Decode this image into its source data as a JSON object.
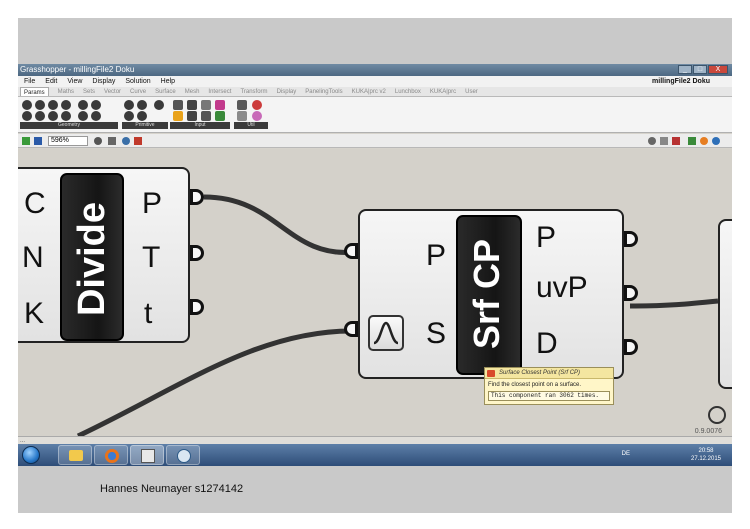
{
  "window": {
    "title": "Grasshopper - millingFile2 Doku",
    "doc_name": "millingFile2 Doku",
    "controls": [
      "_",
      "□",
      "X"
    ]
  },
  "menu": [
    "File",
    "Edit",
    "View",
    "Display",
    "Solution",
    "Help"
  ],
  "ribbon_tabs": [
    "Params",
    "Maths",
    "Sets",
    "Vector",
    "Curve",
    "Surface",
    "Mesh",
    "Intersect",
    "Transform",
    "Display",
    "PanelingTools",
    "KUKA|prc v2",
    "Lunchbox",
    "KUKA|prc",
    "User"
  ],
  "ribbon_groups": [
    "Geometry",
    "Primitive",
    "Input",
    "Util"
  ],
  "canvas_toolbar": {
    "zoom": "596%"
  },
  "components": {
    "divide": {
      "name": "Divide",
      "inputs": [
        "C",
        "N",
        "K"
      ],
      "outputs": [
        "P",
        "T",
        "t"
      ]
    },
    "srf_cp": {
      "name": "Srf CP",
      "inputs": [
        "P",
        "S"
      ],
      "outputs": [
        "P",
        "uvP",
        "D"
      ]
    }
  },
  "tooltip": {
    "title": "Surface Closest Point (Srf CP)",
    "description": "Find the closest point on a surface.",
    "timing": "This component ran 3062 times."
  },
  "status": {
    "left": "...",
    "version": "0.9.0076"
  },
  "taskbar": {
    "language": "DE",
    "time": "20:58",
    "date": "27.12.2015"
  },
  "caption": "Hannes Neumayer s1274142"
}
